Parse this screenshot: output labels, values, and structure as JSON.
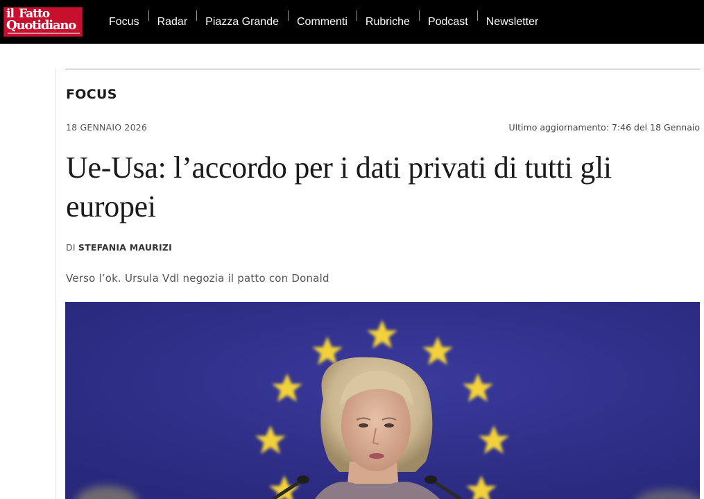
{
  "site": {
    "logo_line1_a": "il",
    "logo_line1_b": "Fatto",
    "logo_line2": "Quotidiano",
    "brand_color": "#c8102e"
  },
  "nav": {
    "items": [
      "Focus",
      "Radar",
      "Piazza Grande",
      "Commenti",
      "Rubriche",
      "Podcast",
      "Newsletter"
    ]
  },
  "article": {
    "section": "FOCUS",
    "date": "18 GENNAIO 2026",
    "updated": "Ultimo aggiornamento: 7:46 del 18 Gennaio",
    "title": "Ue-Usa: l’accordo per i dati privati di tutti gli europei",
    "byline_prefix": "DI",
    "author": "STEFANIA MAURIZI",
    "subtitle": "Verso l’ok. Ursula Vdl negozia il patto con Donald",
    "image": {
      "subject": "eu-flag-speaker-photo",
      "background_color": "#2f2f8e",
      "star_color": "#f2d13a"
    }
  }
}
